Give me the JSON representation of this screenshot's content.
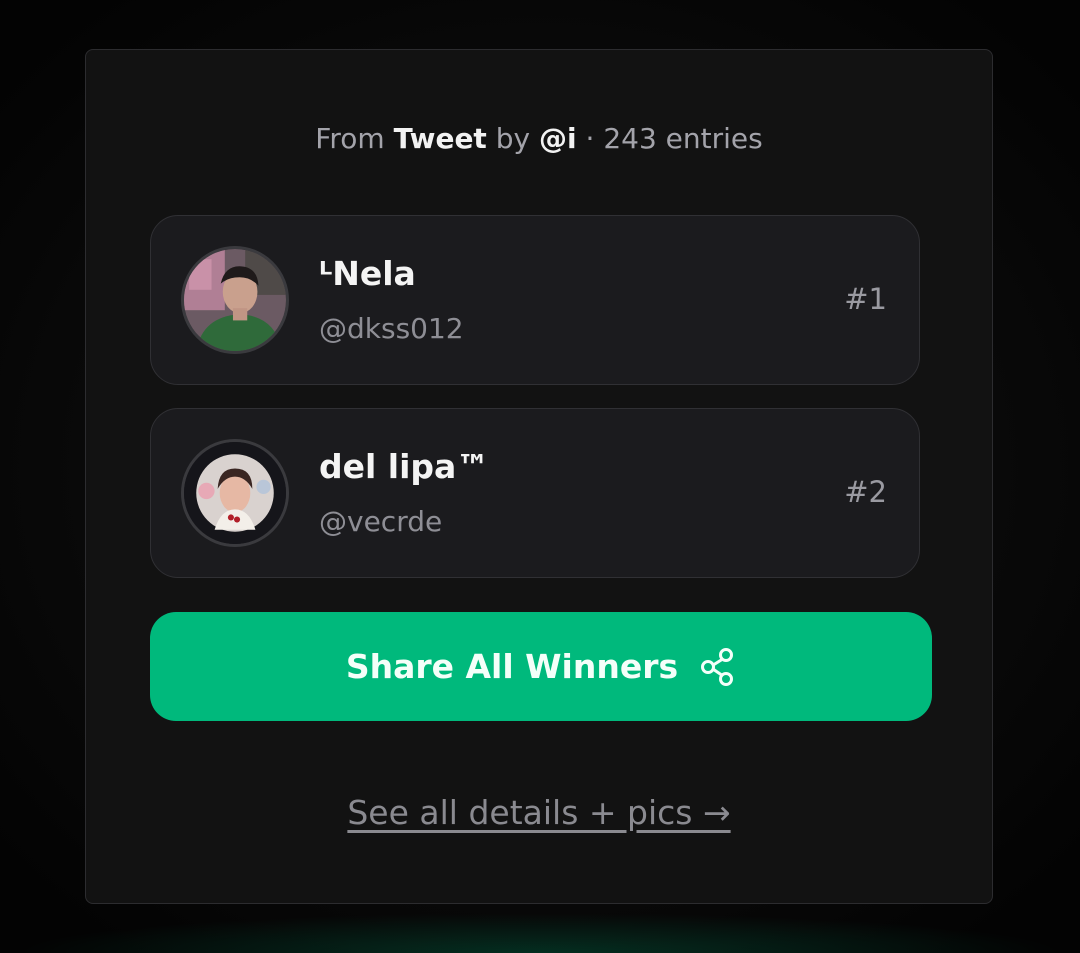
{
  "header": {
    "prefix": "From",
    "source": "Tweet",
    "by": "by",
    "author": "@i",
    "separator": "·",
    "entries": "243 entries"
  },
  "winners": [
    {
      "name": "ᴸNela",
      "handle": "@dkss012",
      "rank": "#1",
      "avatar_icon": "user-avatar"
    },
    {
      "name": "del lipa™",
      "handle": "@vecrde",
      "rank": "#2",
      "avatar_icon": "user-avatar"
    }
  ],
  "share_button": {
    "label": "Share All Winners",
    "icon": "share-icon"
  },
  "details_link": {
    "label": "See all details + pics →"
  },
  "colors": {
    "accent": "#00b97c",
    "card_background": "#121212",
    "winner_background": "#1b1b1e",
    "muted_text": "#8e8e95"
  }
}
